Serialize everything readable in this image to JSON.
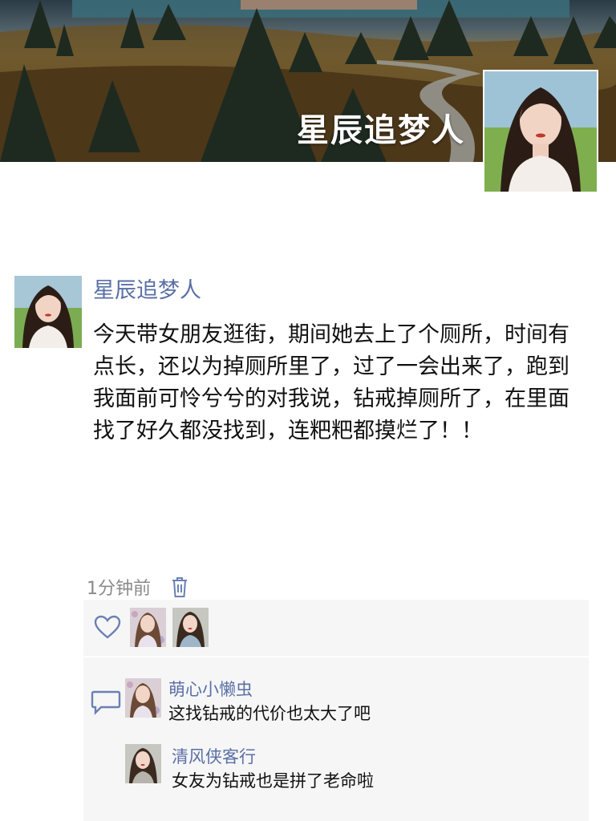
{
  "cover": {
    "title": "星辰追梦人",
    "avatar": "profile-portrait-image"
  },
  "post": {
    "author": "星辰追梦人",
    "content": "今天带女朋友逛街，期间她去上了个厕所，时间有点长，还以为掉厕所里了，过了一会出来了，跑到我面前可怜兮兮的对我说，钻戒掉厕所了，在里面找了好久都没找到，连粑粑都摸烂了！！",
    "time": "1分钟前",
    "delete_icon": "trash-icon"
  },
  "likes": {
    "icon": "heart-icon",
    "avatars": [
      "avatar-girl-1",
      "avatar-girl-2"
    ]
  },
  "comments": [
    {
      "name": "萌心小懒虫",
      "text": "这找钻戒的代价也太大了吧"
    },
    {
      "name": "清风侠客行",
      "text": "女友为钻戒也是拼了老命啦"
    }
  ],
  "colors": {
    "link": "#5a6fa5",
    "panel": "#f6f6f7",
    "time": "#8a8a8a"
  }
}
